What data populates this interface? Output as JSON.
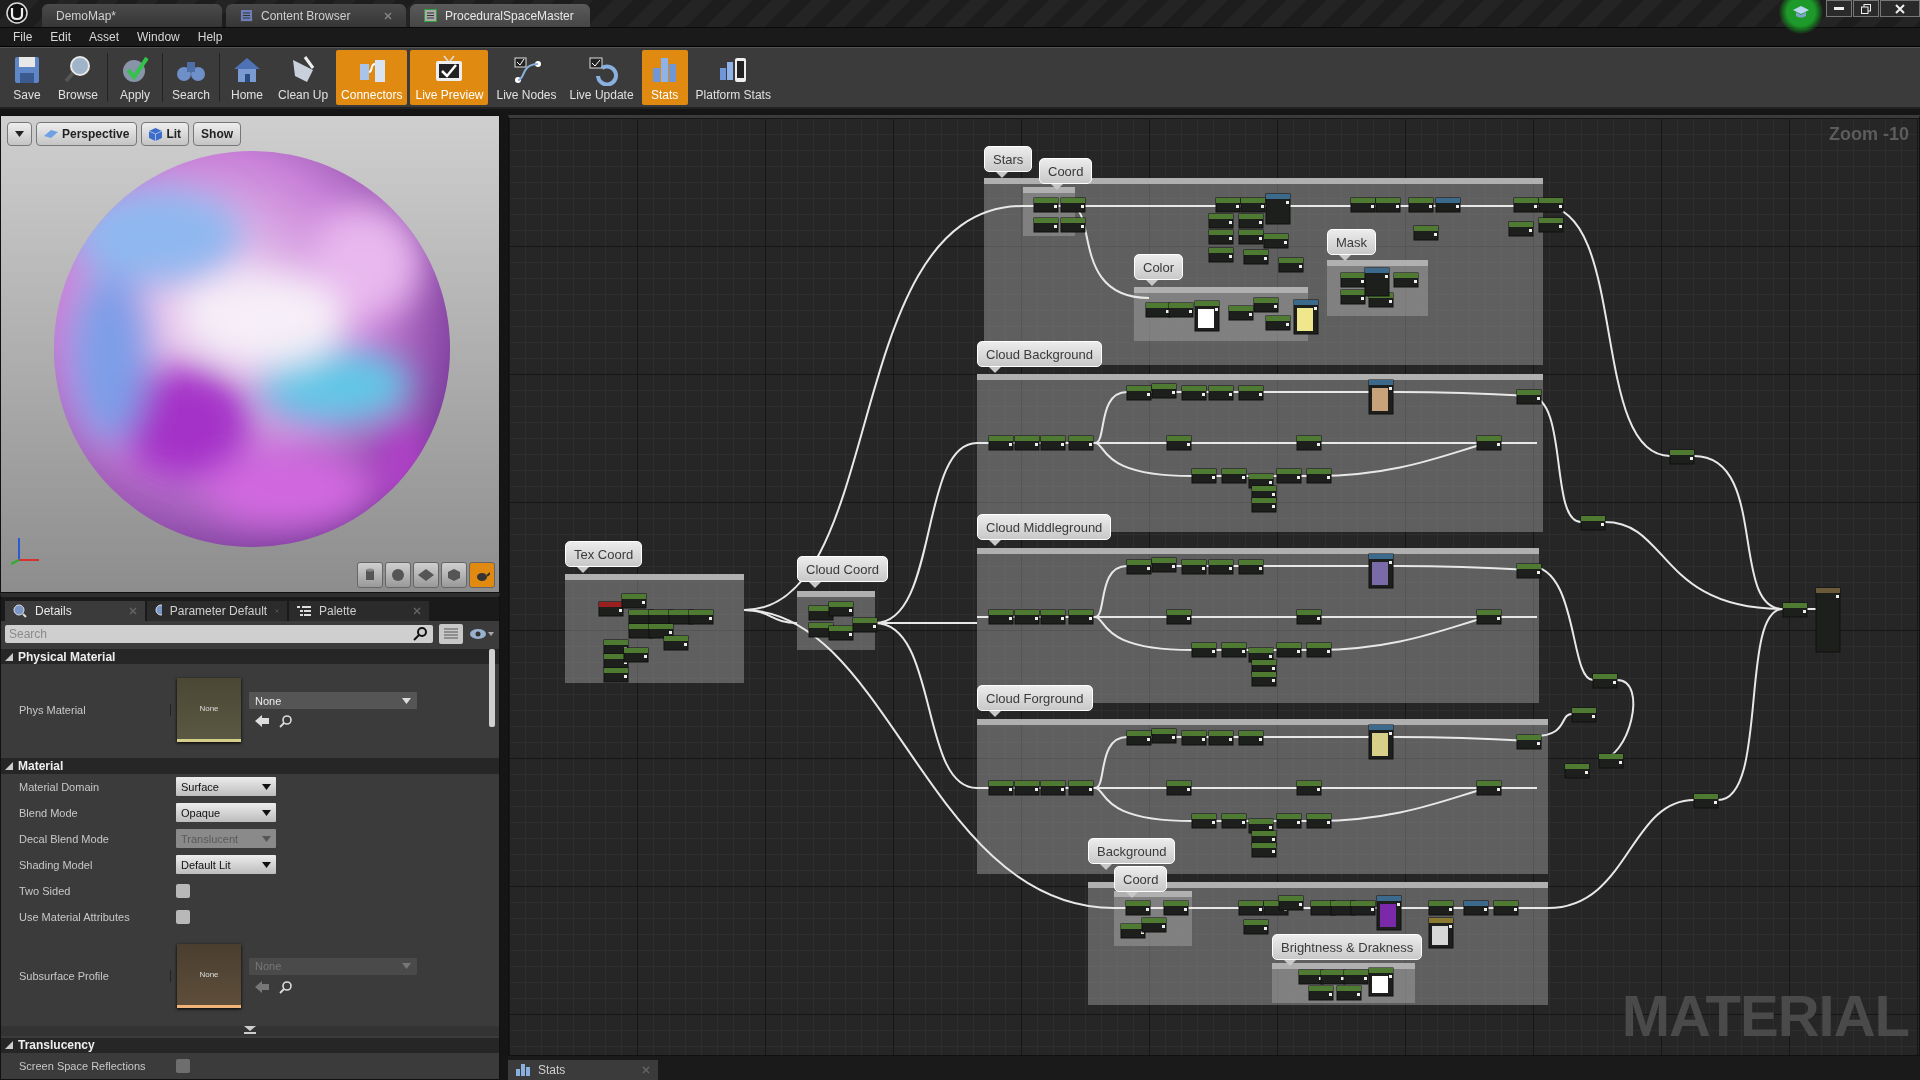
{
  "title_tabs": [
    {
      "label": "DemoMap*",
      "selected": false
    },
    {
      "label": "Content Browser",
      "selected": false
    },
    {
      "label": "ProceduralSpaceMaster",
      "selected": true
    }
  ],
  "menu": [
    "File",
    "Edit",
    "Asset",
    "Window",
    "Help"
  ],
  "toolbar": [
    {
      "label": "Save",
      "on": false
    },
    {
      "label": "Browse",
      "on": false
    },
    {
      "label": "Apply",
      "on": false
    },
    {
      "label": "Search",
      "on": false
    },
    {
      "label": "Home",
      "on": false
    },
    {
      "label": "Clean Up",
      "on": false
    },
    {
      "label": "Connectors",
      "on": true
    },
    {
      "label": "Live Preview",
      "on": true
    },
    {
      "label": "Live Nodes",
      "on": false
    },
    {
      "label": "Live Update",
      "on": false
    },
    {
      "label": "Stats",
      "on": true
    },
    {
      "label": "Platform Stats",
      "on": false
    }
  ],
  "viewport": {
    "buttons": [
      "Perspective",
      "Lit",
      "Show"
    ]
  },
  "details": {
    "tabs": [
      {
        "label": "Details",
        "selected": true
      },
      {
        "label": "Parameter Default",
        "selected": false
      },
      {
        "label": "Palette",
        "selected": false
      }
    ],
    "search": {
      "placeholder": "Search"
    },
    "sections": [
      {
        "title": "Physical Material",
        "expanded": true,
        "rows": [
          {
            "kind": "asset",
            "label": "Phys Material",
            "thumbnail": "None",
            "value": "None",
            "disabled": false,
            "color": "#d6cf8c"
          }
        ]
      },
      {
        "title": "Material",
        "expanded": true,
        "rows": [
          {
            "kind": "dropdown",
            "label": "Material Domain",
            "value": "Surface",
            "disabled": false
          },
          {
            "kind": "dropdown",
            "label": "Blend Mode",
            "value": "Opaque",
            "disabled": false
          },
          {
            "kind": "dropdown",
            "label": "Decal Blend Mode",
            "value": "Translucent",
            "disabled": true
          },
          {
            "kind": "dropdown",
            "label": "Shading Model",
            "value": "Default Lit",
            "disabled": false
          },
          {
            "kind": "checkbox",
            "label": "Two Sided",
            "checked": false,
            "disabled": false
          },
          {
            "kind": "checkbox",
            "label": "Use Material Attributes",
            "checked": false,
            "disabled": false
          },
          {
            "kind": "asset",
            "label": "Subsurface Profile",
            "thumbnail": "None",
            "value": "None",
            "disabled": true,
            "color": "#f0b47a"
          }
        ]
      },
      {
        "title": "Translucency",
        "expanded": true,
        "rows": [
          {
            "kind": "checkbox",
            "label": "Screen Space Reflections",
            "checked": false,
            "disabled": true
          }
        ]
      }
    ]
  },
  "graph": {
    "zoom": "Zoom -10",
    "watermark": "MATERIAL",
    "comments": [
      {
        "title": "Stars"
      },
      {
        "title": "Coord"
      },
      {
        "title": "Color"
      },
      {
        "title": "Mask"
      },
      {
        "title": "Cloud Background"
      },
      {
        "title": "Cloud Middleground"
      },
      {
        "title": "Cloud Forground"
      },
      {
        "title": "Tex Coord"
      },
      {
        "title": "Cloud Coord"
      },
      {
        "title": "Background"
      },
      {
        "title": "Coord"
      },
      {
        "title": "Brightness & Drakness"
      }
    ]
  },
  "bottom_tabs": [
    {
      "label": "Stats",
      "selected": true
    }
  ]
}
